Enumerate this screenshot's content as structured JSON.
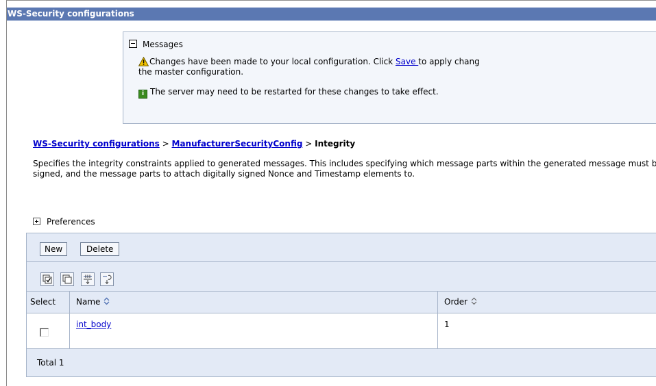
{
  "window": {
    "title": "WS-Security configurations"
  },
  "messages": {
    "header": "Messages",
    "warning_before": "Changes have been made to your local configuration. Click ",
    "save_link": "Save ",
    "warning_after": "to apply changes to the master configuration.",
    "warning_line1_after": "to apply chang",
    "warning_line2": "the master configuration.",
    "info": "The server may need to be restarted for these changes to take effect."
  },
  "breadcrumb": {
    "root": "WS-Security configurations",
    "separator": ">",
    "parent": "ManufacturerSecurityConfig",
    "current": "Integrity"
  },
  "description": "Specifies the integrity constraints applied to generated messages. This includes specifying which message parts within the generated message must be digitally signed, and the message parts to attach digitally signed Nonce and Timestamp elements to.",
  "preferences": {
    "label": "Preferences"
  },
  "table": {
    "buttons": {
      "new": "New",
      "delete": "Delete"
    },
    "icons": [
      "select-all-icon",
      "deselect-all-icon",
      "show-filter-icon",
      "clear-filter-icon"
    ],
    "columns": {
      "select": "Select",
      "name": "Name",
      "order": "Order"
    },
    "rows": [
      {
        "name": "int_body",
        "order": "1"
      }
    ],
    "total": "Total 1"
  },
  "colors": {
    "title_bar": "#5b78b2",
    "panel_bg": "#f3f6fb",
    "table_band": "#e3eaf6",
    "link": "#0000cc",
    "warning": "#f2c200",
    "info": "#3a8a1f"
  }
}
